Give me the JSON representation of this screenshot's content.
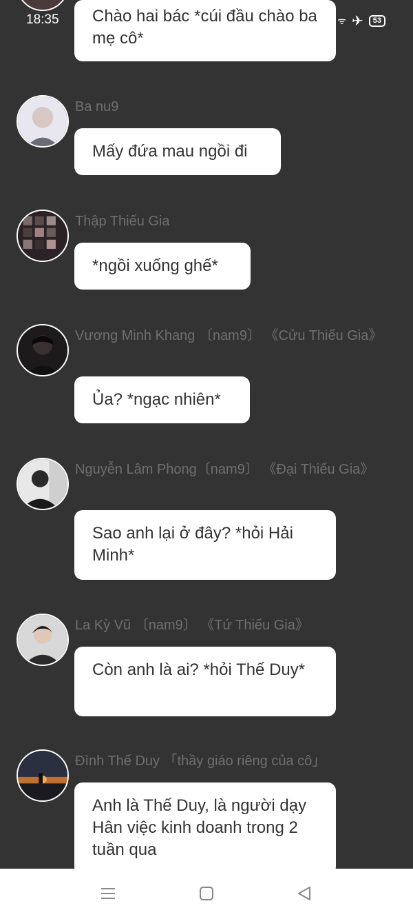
{
  "status_bar": {
    "time": "18:35",
    "battery": "53"
  },
  "messages": [
    {
      "name": "",
      "text": "Chào hai bác *cúi đầu chào ba mẹ cô*"
    },
    {
      "name": "Ba nu9",
      "text": "Mấy đứa mau ngồi đi"
    },
    {
      "name": "Thập Thiếu Gia",
      "text": "*ngồi xuống ghế*"
    },
    {
      "name": "Vương Minh Khang 〔nam9〕 《Cửu Thiếu Gia》",
      "text": "Ủa? *ngạc nhiên*"
    },
    {
      "name": "Nguyễn Lâm Phong〔nam9〕 《Đại Thiếu Gia》",
      "text": "Sao anh lại ở đây? *hỏi Hải Minh*"
    },
    {
      "name": "La Kỳ Vũ 〔nam9〕 《Tứ Thiếu Gia》",
      "text": "Còn anh là ai? *hỏi Thế Duy*"
    },
    {
      "name": "Đình Thế Duy 「thầy giáo riêng của cô」",
      "text": "Anh là Thế Duy, là người dạy Hân việc kinh doanh trong 2 tuần qua"
    }
  ],
  "nav": {
    "menu_icon": "menu-icon",
    "home_icon": "home-icon",
    "back_icon": "back-icon"
  }
}
